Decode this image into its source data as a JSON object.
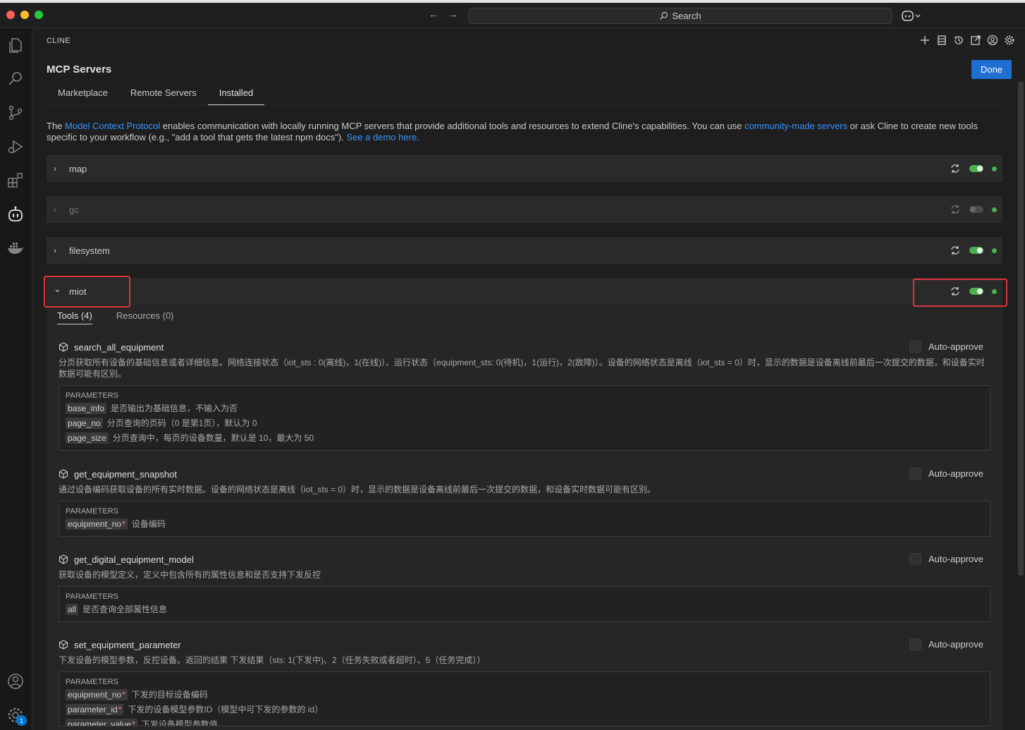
{
  "titlebar": {
    "search_label": "Search",
    "back_arrow": "←",
    "forward_arrow": "→"
  },
  "activity_bar": {
    "items": [
      "explorer-icon",
      "search-icon",
      "source-control-icon",
      "run-debug-icon",
      "extensions-icon",
      "cline-robot-icon",
      "docker-icon",
      "account-icon",
      "settings-gear-icon"
    ],
    "settings_badge": "1"
  },
  "panel": {
    "header": "CLINE",
    "header_icons": [
      "plus-icon",
      "server-stack-icon",
      "history-icon",
      "popout-icon",
      "account-circle-icon",
      "gear-icon"
    ],
    "title": "MCP Servers",
    "done_label": "Done",
    "tabs": [
      {
        "label": "Marketplace",
        "active": false
      },
      {
        "label": "Remote Servers",
        "active": false
      },
      {
        "label": "Installed",
        "active": true
      }
    ],
    "intro": {
      "t1": "The ",
      "link1": "Model Context Protocol",
      "t2": " enables communication with locally running MCP servers that provide additional tools and resources to extend Cline's capabilities. You can use ",
      "link2": "community-made servers",
      "t3": " or ask Cline to create new tools specific to your workflow (e.g., \"add a tool that gets the latest npm docs\"). ",
      "link3": "See a demo here."
    }
  },
  "servers": [
    {
      "name": "map",
      "enabled": true,
      "expanded": false,
      "chevron": "›"
    },
    {
      "name": "gc",
      "enabled": false,
      "expanded": false,
      "chevron": "›"
    },
    {
      "name": "filesystem",
      "enabled": true,
      "expanded": false,
      "chevron": "›"
    },
    {
      "name": "miot",
      "enabled": true,
      "expanded": true,
      "chevron": "⌄"
    }
  ],
  "miot": {
    "subtabs": [
      {
        "label": "Tools (4)",
        "active": true
      },
      {
        "label": "Resources (0)",
        "active": false
      }
    ],
    "auto_approve_label": "Auto-approve",
    "params_label": "PARAMETERS",
    "tools": [
      {
        "name": "search_all_equipment",
        "description": "分页获取所有设备的基础信息或者详细信息。网络连接状态（iot_sts : 0(离线)，1(在线)）、运行状态（equipment_sts: 0(待机)，1(运行)，2(故障)）。设备的网络状态是离线（iot_sts = 0）时，显示的数据是设备离线前最后一次提交的数据，和设备实时数据可能有区别。",
        "params": [
          {
            "name": "base_info",
            "required": false,
            "desc": "是否输出为基础信息，不输入为否"
          },
          {
            "name": "page_no",
            "required": false,
            "desc": "分页查询的页码（0 是第1页），默认为 0"
          },
          {
            "name": "page_size",
            "required": false,
            "desc": "分页查询中，每页的设备数量，默认是 10，最大为 50"
          }
        ]
      },
      {
        "name": "get_equipment_snapshot",
        "description": "通过设备编码获取设备的所有实时数据。设备的网络状态是离线（iot_sts = 0）时，显示的数据是设备离线前最后一次提交的数据，和设备实时数据可能有区别。",
        "params": [
          {
            "name": "equipment_no",
            "required": true,
            "desc": "设备编码"
          }
        ]
      },
      {
        "name": "get_digital_equipment_model",
        "description": "获取设备的模型定义，定义中包含所有的属性信息和是否支持下发反控",
        "params": [
          {
            "name": "all",
            "required": false,
            "desc": "是否查询全部属性信息"
          }
        ]
      },
      {
        "name": "set_equipment_parameter",
        "description": "下发设备的模型参数，反控设备。返回的结果 下发结果（sts: 1(下发中)、2（任务失败或者超时）、5（任务完成））",
        "params": [
          {
            "name": "equipment_no",
            "required": true,
            "desc": "下发的目标设备编码"
          },
          {
            "name": "parameter_id",
            "required": true,
            "desc": "下发的设备模型参数ID（模型中可下发的参数的 id）"
          },
          {
            "name": "parameter_value",
            "required": true,
            "desc": "下发设备模型参数值"
          }
        ]
      }
    ]
  },
  "colors": {
    "accent": "#1f6fd0",
    "link": "#3794ff",
    "toggle_on": "#4caf50",
    "highlight": "#e0343e"
  }
}
